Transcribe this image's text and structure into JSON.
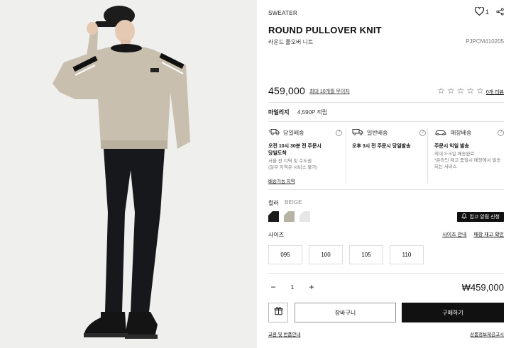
{
  "product": {
    "category": "SWEATER",
    "title": "ROUND PULLOVER KNIT",
    "subtitle": "라운드 풀오버 니트",
    "code": "PJPCM410205",
    "likes": "1",
    "price": "459,000",
    "installment": "최대 10개월 무이자",
    "reviews": "0개 리뷰",
    "rating_stars": 0
  },
  "icons": {
    "like": "heart-icon",
    "share": "share-icon",
    "gift": "gift-icon",
    "bell": "bell-icon",
    "help": "question-icon"
  },
  "mileage": {
    "label": "마일리지",
    "value": "4,590P 적립"
  },
  "shipping": [
    {
      "icon": "truck-fast-icon",
      "title": "당일배송",
      "line1": "오전 10시 30분 전 주문시",
      "line1b": "당일도착",
      "line2": "서울 전 지역 및 수도권",
      "line3": "(일부 지역은 서비스 불가)"
    },
    {
      "icon": "truck-icon",
      "title": "일반배송",
      "line1": "오후 3시 전 주문시 당일발송",
      "line1b": "",
      "line2": "",
      "line3": ""
    },
    {
      "icon": "store-car-icon",
      "title": "매장배송",
      "line1": "주문시 익일 발송",
      "line1b": "",
      "line2": "최대 3~5일 배송완료",
      "line3": "*온라인 재고 품절시 매장에서 발송되는 서비스"
    }
  ],
  "shipping_link": "배송가능 지역",
  "color": {
    "label": "컬러",
    "selected": "BEIGE",
    "swatches": [
      "#1a1a1a",
      "#b9b3a6",
      "#e6e6e6"
    ]
  },
  "restock_label": "입고 알림 신청",
  "size": {
    "label": "사이즈",
    "guide": "사이즈 안내",
    "stock": "매장 재고 확인",
    "options": [
      "095",
      "100",
      "105",
      "110"
    ]
  },
  "quantity": {
    "minus": "−",
    "value": "1",
    "plus": "+"
  },
  "total": "₩459,000",
  "buttons": {
    "cart": "장바구니",
    "buy": "구매하기"
  },
  "footer": {
    "left": "교환 및 반품안내",
    "right": "상품정보제공고시"
  }
}
